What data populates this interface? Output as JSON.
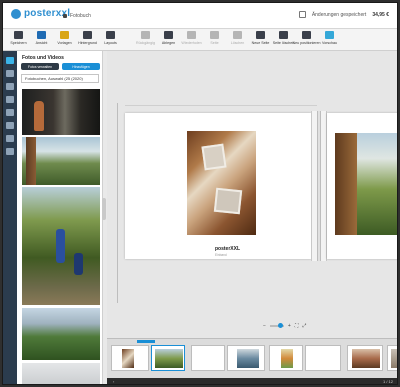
{
  "app": {
    "logo_text": "posterxxl",
    "project_label": "Fotobuch",
    "save_status": "Änderungen gespeichert",
    "price": "34,95 €"
  },
  "toolbar": {
    "items": [
      {
        "label": "Speichern",
        "icon": "save-icon"
      },
      {
        "label": "Ansicht",
        "icon": "view-icon"
      },
      {
        "label": "Vorlagen",
        "icon": "templates-icon"
      },
      {
        "label": "Hintergrund",
        "icon": "background-icon"
      },
      {
        "label": "Layouts",
        "icon": "layouts-icon"
      },
      {
        "label": "Rückgängig",
        "icon": "undo-icon"
      },
      {
        "label": "Ablegen",
        "icon": "clipboard-icon"
      },
      {
        "label": "Wiederholen",
        "icon": "redo-icon"
      },
      {
        "label": "Seite",
        "icon": "page-icon"
      },
      {
        "label": "Löschen",
        "icon": "delete-icon"
      },
      {
        "label": "Neue Seite",
        "icon": "new-page-icon"
      },
      {
        "label": "Seite löschen",
        "icon": "delete-page-icon"
      },
      {
        "label": "Neu positionieren",
        "icon": "reposition-icon"
      },
      {
        "label": "Vorschau",
        "icon": "preview-icon"
      }
    ]
  },
  "panel": {
    "title": "Fotos und Videos",
    "btn_manage": "Fotos verwalten",
    "btn_add": "Hinzufügen",
    "album": "Fotobuchen, Auswahl (25 (2020)"
  },
  "canvas": {
    "cover_title": "posterXXL",
    "cover_subtitle": "Einband"
  },
  "zoom": {
    "zoom_out": "−",
    "zoom_in": "+",
    "fit": "⛶",
    "level": 60
  },
  "filmstrip": {
    "prev_label": "‹",
    "page_count": "1 / 12"
  },
  "colors": {
    "accent": "#1a8fd6",
    "rail": "#2b3c4e",
    "workspace": "#e6e6e6"
  }
}
